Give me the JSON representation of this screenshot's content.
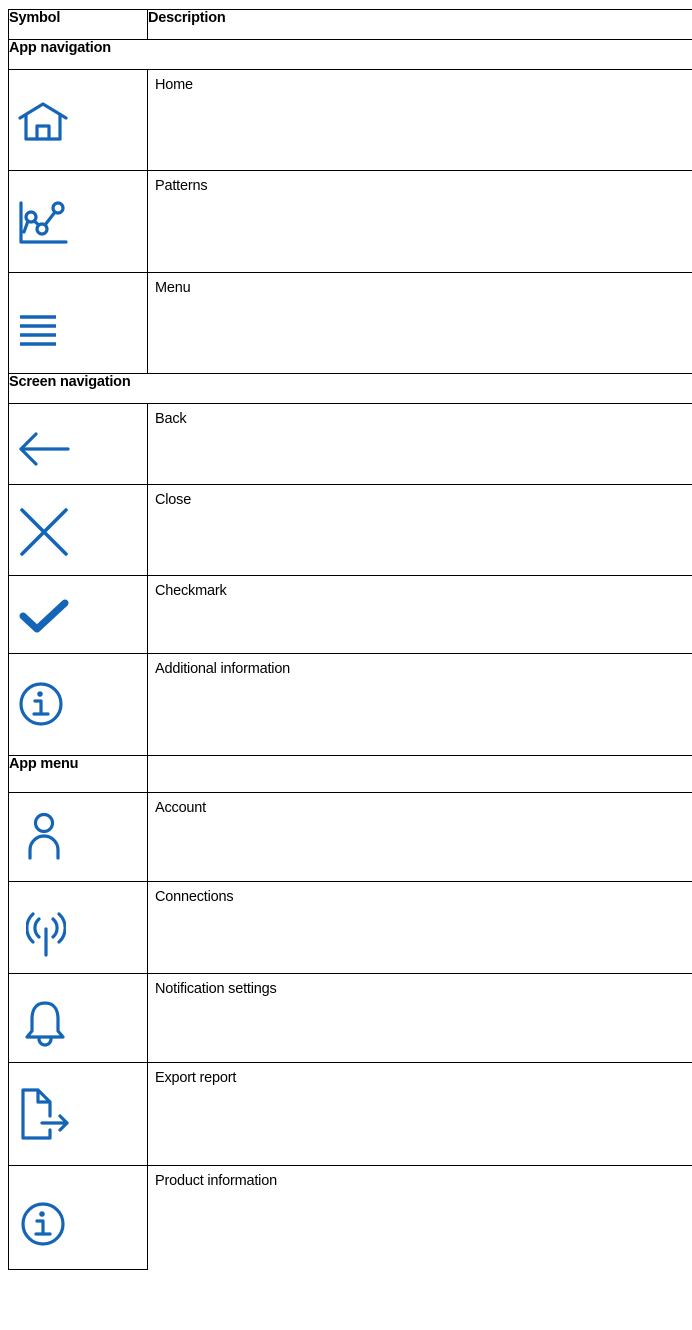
{
  "table": {
    "header": {
      "symbol": "Symbol",
      "description": "Description"
    },
    "sections": [
      {
        "title": "App navigation",
        "rows": [
          {
            "icon": "home-icon",
            "description": "Home"
          },
          {
            "icon": "patterns-icon",
            "description": "Patterns"
          },
          {
            "icon": "menu-icon",
            "description": "Menu"
          }
        ]
      },
      {
        "title": "Screen navigation",
        "rows": [
          {
            "icon": "back-arrow-icon",
            "description": "Back"
          },
          {
            "icon": "close-icon",
            "description": "Close"
          },
          {
            "icon": "checkmark-icon",
            "description": "Checkmark"
          },
          {
            "icon": "info-icon",
            "description": "Additional information"
          }
        ]
      },
      {
        "title": "App menu",
        "rows": [
          {
            "icon": "account-icon",
            "description": "Account"
          },
          {
            "icon": "connections-icon",
            "description": "Connections"
          },
          {
            "icon": "bell-icon",
            "description": "Notification settings"
          },
          {
            "icon": "export-report-icon",
            "description": "Export report"
          },
          {
            "icon": "info-icon",
            "description": "Product information"
          }
        ]
      }
    ]
  },
  "colors": {
    "icon": "#1565b7",
    "border": "#000000"
  }
}
